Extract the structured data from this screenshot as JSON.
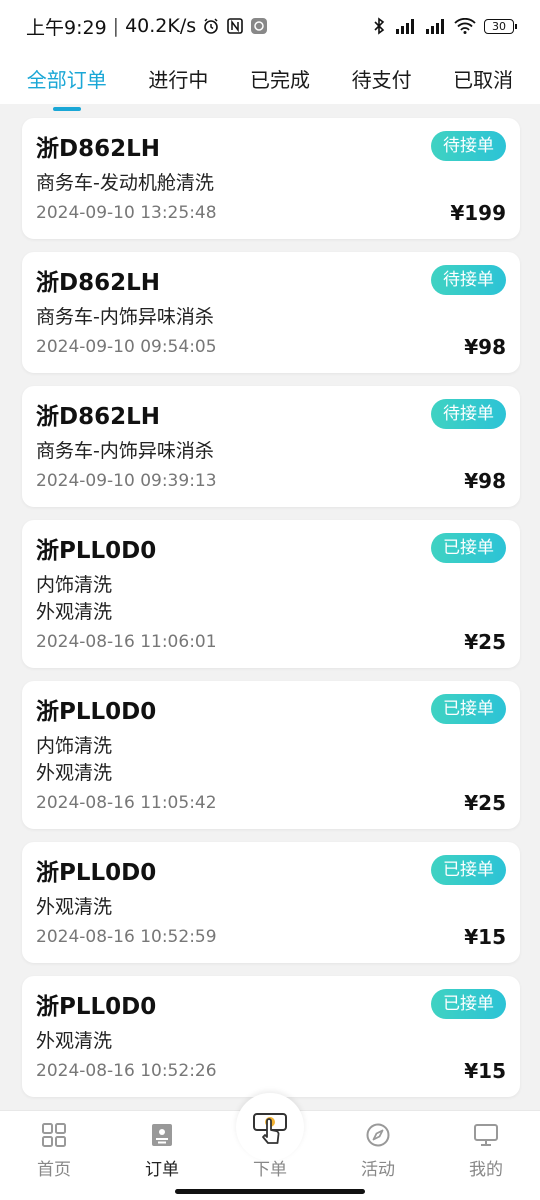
{
  "status_bar": {
    "time": "上午9:29",
    "network_speed": "40.2K/s",
    "battery": "30",
    "icons": [
      "alarm-icon",
      "nfc-icon",
      "app-notification-icon",
      "bluetooth-icon",
      "signal-icon",
      "signal-icon",
      "wifi-icon",
      "battery-icon"
    ]
  },
  "tabs": [
    {
      "label": "全部订单",
      "active": true
    },
    {
      "label": "进行中",
      "active": false
    },
    {
      "label": "已完成",
      "active": false
    },
    {
      "label": "待支付",
      "active": false
    },
    {
      "label": "已取消",
      "active": false
    }
  ],
  "orders": [
    {
      "plate": "浙D862LH",
      "status": "待接单",
      "services": [
        "商务车-发动机舱清洗"
      ],
      "time": "2024-09-10 13:25:48",
      "price": "¥199"
    },
    {
      "plate": "浙D862LH",
      "status": "待接单",
      "services": [
        "商务车-内饰异味消杀"
      ],
      "time": "2024-09-10 09:54:05",
      "price": "¥98"
    },
    {
      "plate": "浙D862LH",
      "status": "待接单",
      "services": [
        "商务车-内饰异味消杀"
      ],
      "time": "2024-09-10 09:39:13",
      "price": "¥98"
    },
    {
      "plate": "浙PLL0D0",
      "status": "已接单",
      "services": [
        "内饰清洗",
        "外观清洗"
      ],
      "time": "2024-08-16 11:06:01",
      "price": "¥25"
    },
    {
      "plate": "浙PLL0D0",
      "status": "已接单",
      "services": [
        "内饰清洗",
        "外观清洗"
      ],
      "time": "2024-08-16 11:05:42",
      "price": "¥25"
    },
    {
      "plate": "浙PLL0D0",
      "status": "已接单",
      "services": [
        "外观清洗"
      ],
      "time": "2024-08-16 10:52:59",
      "price": "¥15"
    },
    {
      "plate": "浙PLL0D0",
      "status": "已接单",
      "services": [
        "外观清洗"
      ],
      "time": "2024-08-16 10:52:26",
      "price": "¥15"
    }
  ],
  "bottom_nav": [
    {
      "label": "首页",
      "icon": "home-grid-icon",
      "active": false
    },
    {
      "label": "订单",
      "icon": "order-icon",
      "active": true
    },
    {
      "label": "下单",
      "icon": "place-order-hand-icon",
      "active": false
    },
    {
      "label": "活动",
      "icon": "compass-icon",
      "active": false
    },
    {
      "label": "我的",
      "icon": "monitor-icon",
      "active": false
    }
  ],
  "colors": {
    "accent": "#1aa7d6",
    "badge_gradient_start": "#3fd2c2",
    "badge_gradient_end": "#2cc3d6",
    "background": "#f2f2f2"
  }
}
